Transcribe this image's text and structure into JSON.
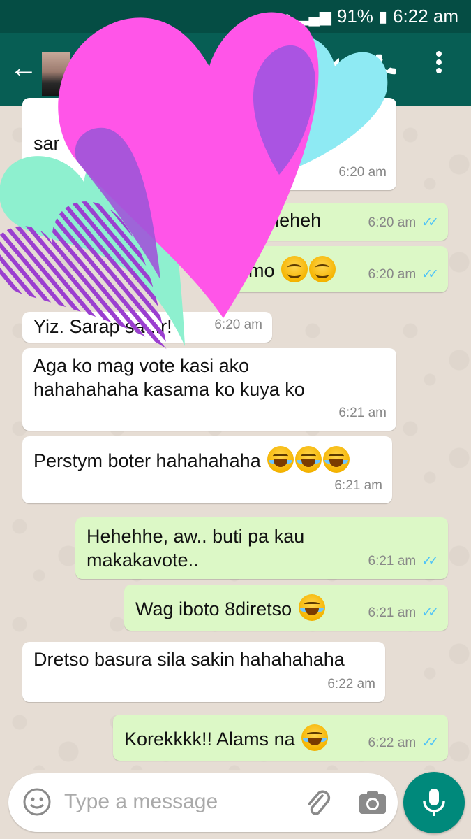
{
  "status_bar": {
    "battery": "91%",
    "time": "6:22 am"
  },
  "header": {
    "back_icon": "arrow-left-icon",
    "icons": [
      "video-call-icon",
      "phone-icon",
      "more-vert-icon"
    ]
  },
  "messages": [
    {
      "dir": "in",
      "text": "sar",
      "time": "6:20 am"
    },
    {
      "dir": "out",
      "text": "hehheheh",
      "time": "6:20 am",
      "read": true
    },
    {
      "dir": "out",
      "text": "mo",
      "emoji": [
        "smile",
        "smile"
      ],
      "time": "6:20 am",
      "read": true
    },
    {
      "dir": "in",
      "text": "Yiz. Sarap sa...r!",
      "time": "6:20 am"
    },
    {
      "dir": "in",
      "text": "Aga ko mag vote kasi ako",
      "text2": "hahahahaha kasama ko kuya ko",
      "time": "6:21 am"
    },
    {
      "dir": "in",
      "text": "Perstym boter hahahahaha",
      "emoji": [
        "laugh",
        "laugh",
        "laugh"
      ],
      "time": "6:21 am"
    },
    {
      "dir": "out",
      "text": "Hehehhe, aw.. buti pa kau",
      "text2": "makakavote..",
      "time": "6:21 am",
      "read": true
    },
    {
      "dir": "out",
      "text": "Wag iboto 8diretso",
      "emoji": [
        "laugh"
      ],
      "time": "6:21 am",
      "read": true
    },
    {
      "dir": "in",
      "text": "Dretso basura sila sakin hahahahaha",
      "time": "6:22 am"
    },
    {
      "dir": "out",
      "text": "Korekkkk!! Alams na",
      "emoji": [
        "laugh"
      ],
      "time": "6:22 am",
      "read": true
    }
  ],
  "composer": {
    "placeholder": "Type a message",
    "icons": [
      "emoji-icon",
      "attach-icon",
      "camera-icon",
      "mic-icon"
    ]
  },
  "colors": {
    "header": "#075e54",
    "status_bar": "#054d44",
    "incoming_bubble": "#ffffff",
    "outgoing_bubble": "#dcf8c6",
    "read_ticks": "#4fc3f7",
    "mic_button": "#00897b",
    "heart_pink": "#ff4fe6",
    "heart_cyan": "#8eeaf3",
    "heart_mint": "#8ef0cf",
    "heart_purple": "#9b3fd0"
  }
}
